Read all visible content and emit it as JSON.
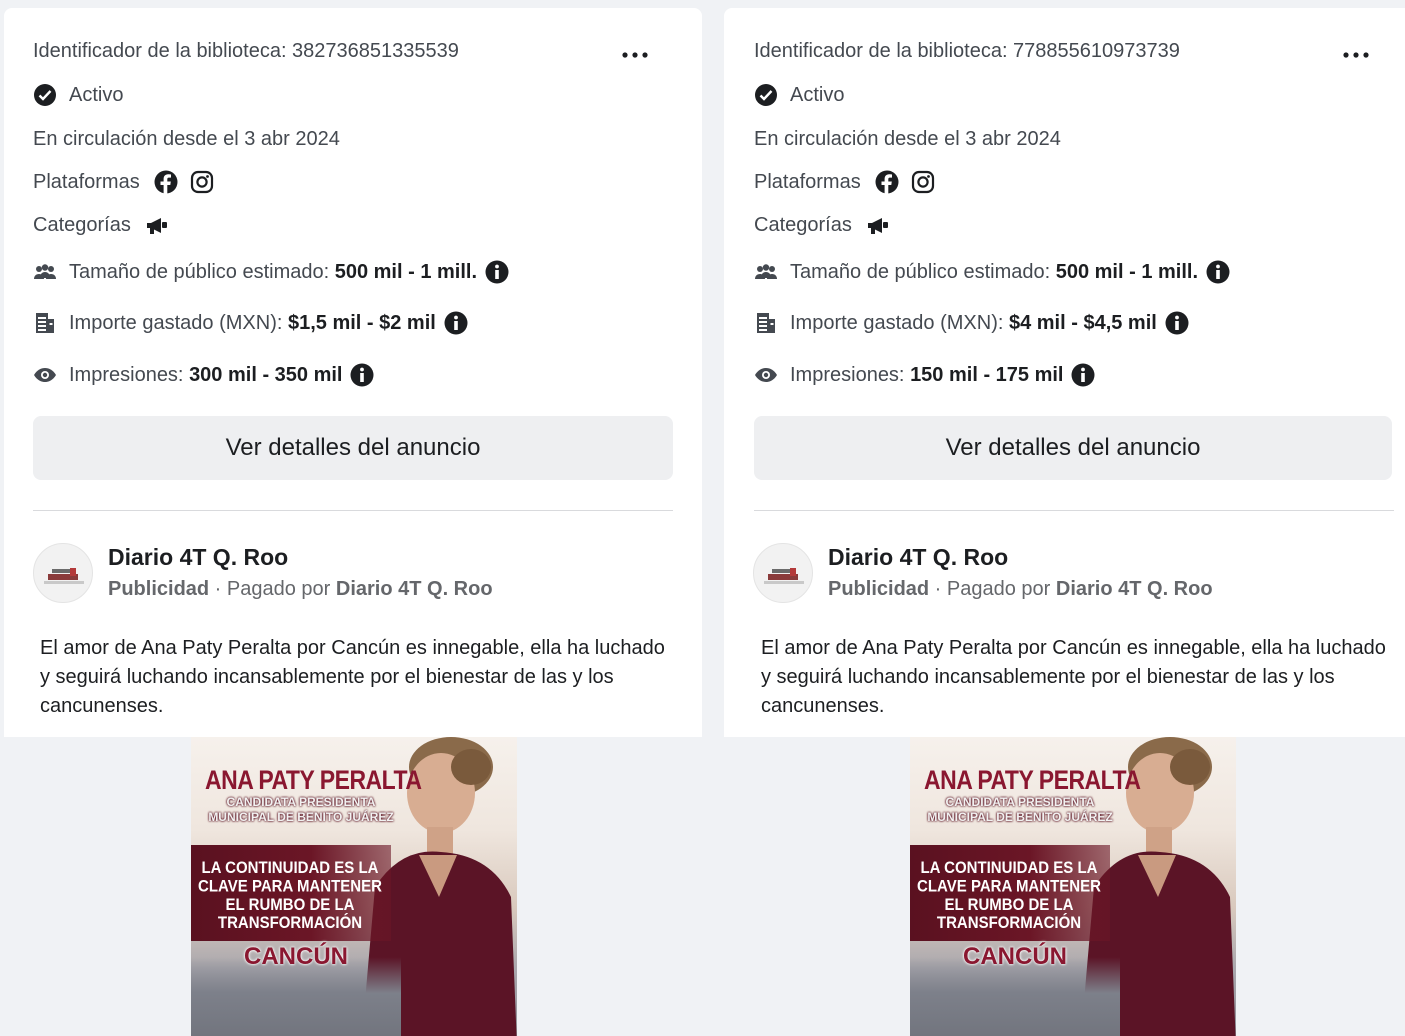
{
  "cards": [
    {
      "library_id": "Identificador de la biblioteca: 382736851335539",
      "status": "Activo",
      "running_since": "En circulación desde el 3 abr 2024",
      "platforms_label": "Plataformas",
      "categories_label": "Categorías",
      "audience_label": "Tamaño de público estimado: ",
      "audience_value": "500 mil - 1 mill.",
      "spend_label": "Importe gastado (MXN): ",
      "spend_value": "$1,5 mil - $2 mil",
      "impressions_label": "Impresiones: ",
      "impressions_value": "300 mil - 350 mil",
      "details_button": "Ver detalles del anuncio",
      "page_name": "Diario 4T Q. Roo",
      "sponsored": "Publicidad",
      "paid_by_prefix": " · Pagado por ",
      "paid_by": "Diario 4T Q. Roo",
      "ad_text": "El amor de Ana Paty Peralta por Cancún es innegable, ella ha luchado y seguirá luchando incansablemente por el bienestar de las y los cancunenses.",
      "poster": {
        "name": "ANA PATY PERALTA",
        "role": "CANDIDATA PRESIDENTA\nMUNICIPAL DE BENITO JUÁREZ",
        "slogan": "LA CONTINUIDAD ES LA\nCLAVE PARA MANTENER\nEL RUMBO DE LA\nTRANSFORMACIÓN",
        "city": "CANCÚN"
      }
    },
    {
      "library_id": "Identificador de la biblioteca: 778855610973739",
      "status": "Activo",
      "running_since": "En circulación desde el 3 abr 2024",
      "platforms_label": "Plataformas",
      "categories_label": "Categorías",
      "audience_label": "Tamaño de público estimado: ",
      "audience_value": "500 mil - 1 mill.",
      "spend_label": "Importe gastado (MXN): ",
      "spend_value": "$4 mil - $4,5 mil",
      "impressions_label": "Impresiones: ",
      "impressions_value": "150 mil - 175 mil",
      "details_button": "Ver detalles del anuncio",
      "page_name": "Diario 4T Q. Roo",
      "sponsored": "Publicidad",
      "paid_by_prefix": " · Pagado por ",
      "paid_by": "Diario 4T Q. Roo",
      "ad_text": "El amor de Ana Paty Peralta por Cancún es innegable, ella ha luchado y seguirá luchando incansablemente por el bienestar de las y los cancunenses.",
      "poster": {
        "name": "ANA PATY PERALTA",
        "role": "CANDIDATA PRESIDENTA\nMUNICIPAL DE BENITO JUÁREZ",
        "slogan": "LA CONTINUIDAD ES LA\nCLAVE PARA MANTENER\nEL RUMBO DE LA\nTRANSFORMACIÓN",
        "city": "CANCÚN"
      }
    }
  ],
  "icons": {
    "more": "more-options-icon",
    "status": "check-circle-icon",
    "facebook": "facebook-icon",
    "instagram": "instagram-icon",
    "category": "megaphone-icon",
    "audience": "people-icon",
    "spend": "receipt-icon",
    "impressions": "eye-icon",
    "info": "info-icon"
  },
  "colors": {
    "page_bg": "#f0f2f5",
    "card_bg": "#ffffff",
    "button_bg": "#eeeff1",
    "text_primary": "#1c1e21",
    "text_secondary": "#65676b",
    "brand_maroon": "#8a1730"
  }
}
